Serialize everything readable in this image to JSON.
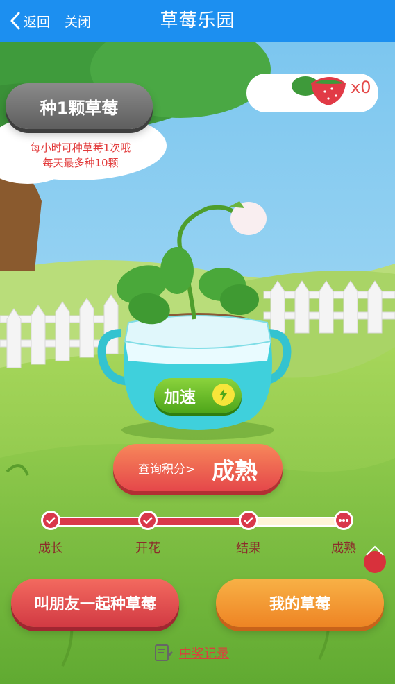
{
  "nav": {
    "back_label": "返回",
    "close_label": "关闭",
    "title": "草莓乐园"
  },
  "plant": {
    "button_label": "种1颗草莓",
    "hint_line1": "每小时可种草莓1次哦",
    "hint_line2": "每天最多种10颗"
  },
  "counter": {
    "text": "x0",
    "icon": "strawberry-icon"
  },
  "pot": {
    "speed_label": "加速",
    "speed_icon": "lightning-icon"
  },
  "status": {
    "link_label": "查询积分>",
    "value": "成熟"
  },
  "progress": {
    "completed_steps": 3,
    "steps": [
      {
        "label": "成长",
        "state": "done"
      },
      {
        "label": "开花",
        "state": "done"
      },
      {
        "label": "结果",
        "state": "done"
      },
      {
        "label": "成熟",
        "state": "pending"
      }
    ]
  },
  "actions": {
    "friends_label": "叫朋友一起种草莓",
    "mine_label": "我的草莓",
    "prize_label": "中奖记录"
  },
  "colors": {
    "nav": "#1c8ff0",
    "accent_red": "#e5474a",
    "accent_orange": "#ee8424",
    "accent_green": "#4ea61a"
  }
}
